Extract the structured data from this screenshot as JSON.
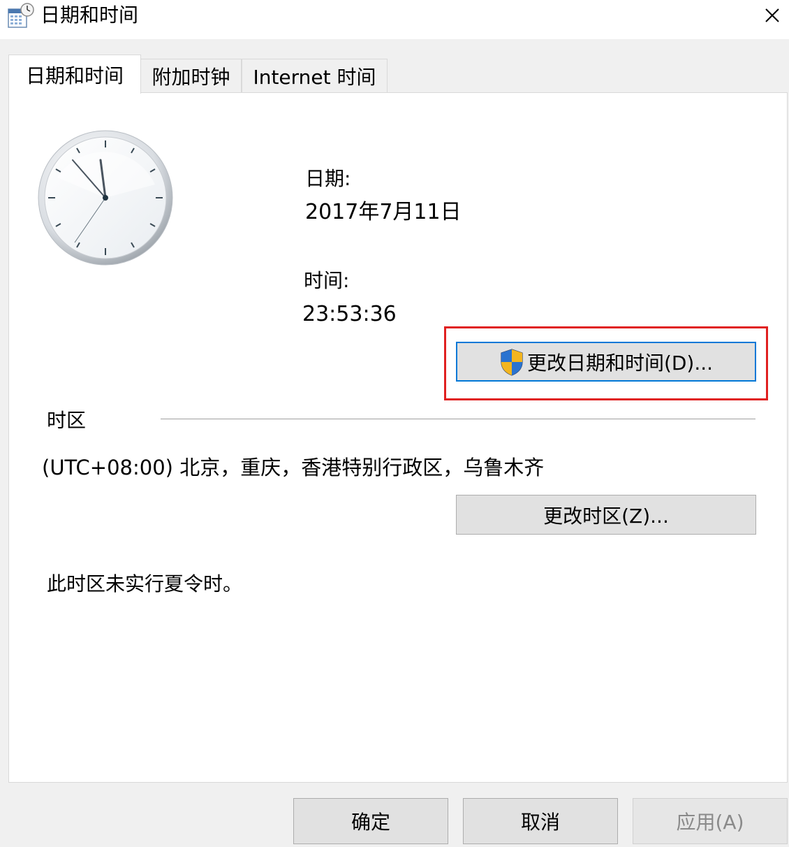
{
  "window": {
    "title": "日期和时间",
    "close_glyph": "✕"
  },
  "tabs": [
    {
      "label": "日期和时间",
      "active": true
    },
    {
      "label": "附加时钟",
      "active": false
    },
    {
      "label": "Internet 时间",
      "active": false
    }
  ],
  "datetime": {
    "date_label": "日期:",
    "date_value": "2017年7月11日",
    "time_label": "时间:",
    "time_value": "23:53:36",
    "change_button": "更改日期和时间(D)..."
  },
  "timezone": {
    "section_label": "时区",
    "value": "(UTC+08:00) 北京，重庆，香港特别行政区，乌鲁木齐",
    "change_button": "更改时区(Z)...",
    "dst_note": "此时区未实行夏令时。"
  },
  "footer": {
    "ok": "确定",
    "cancel": "取消",
    "apply": "应用(A)"
  },
  "icons": {
    "app": "calendar-clock-icon",
    "clock": "analog-clock-icon",
    "shield": "uac-shield-icon",
    "close": "close-icon"
  },
  "colors": {
    "highlight_box": "#e02020",
    "default_button_border": "#0078d7",
    "dialog_background": "#f0f0f0"
  }
}
